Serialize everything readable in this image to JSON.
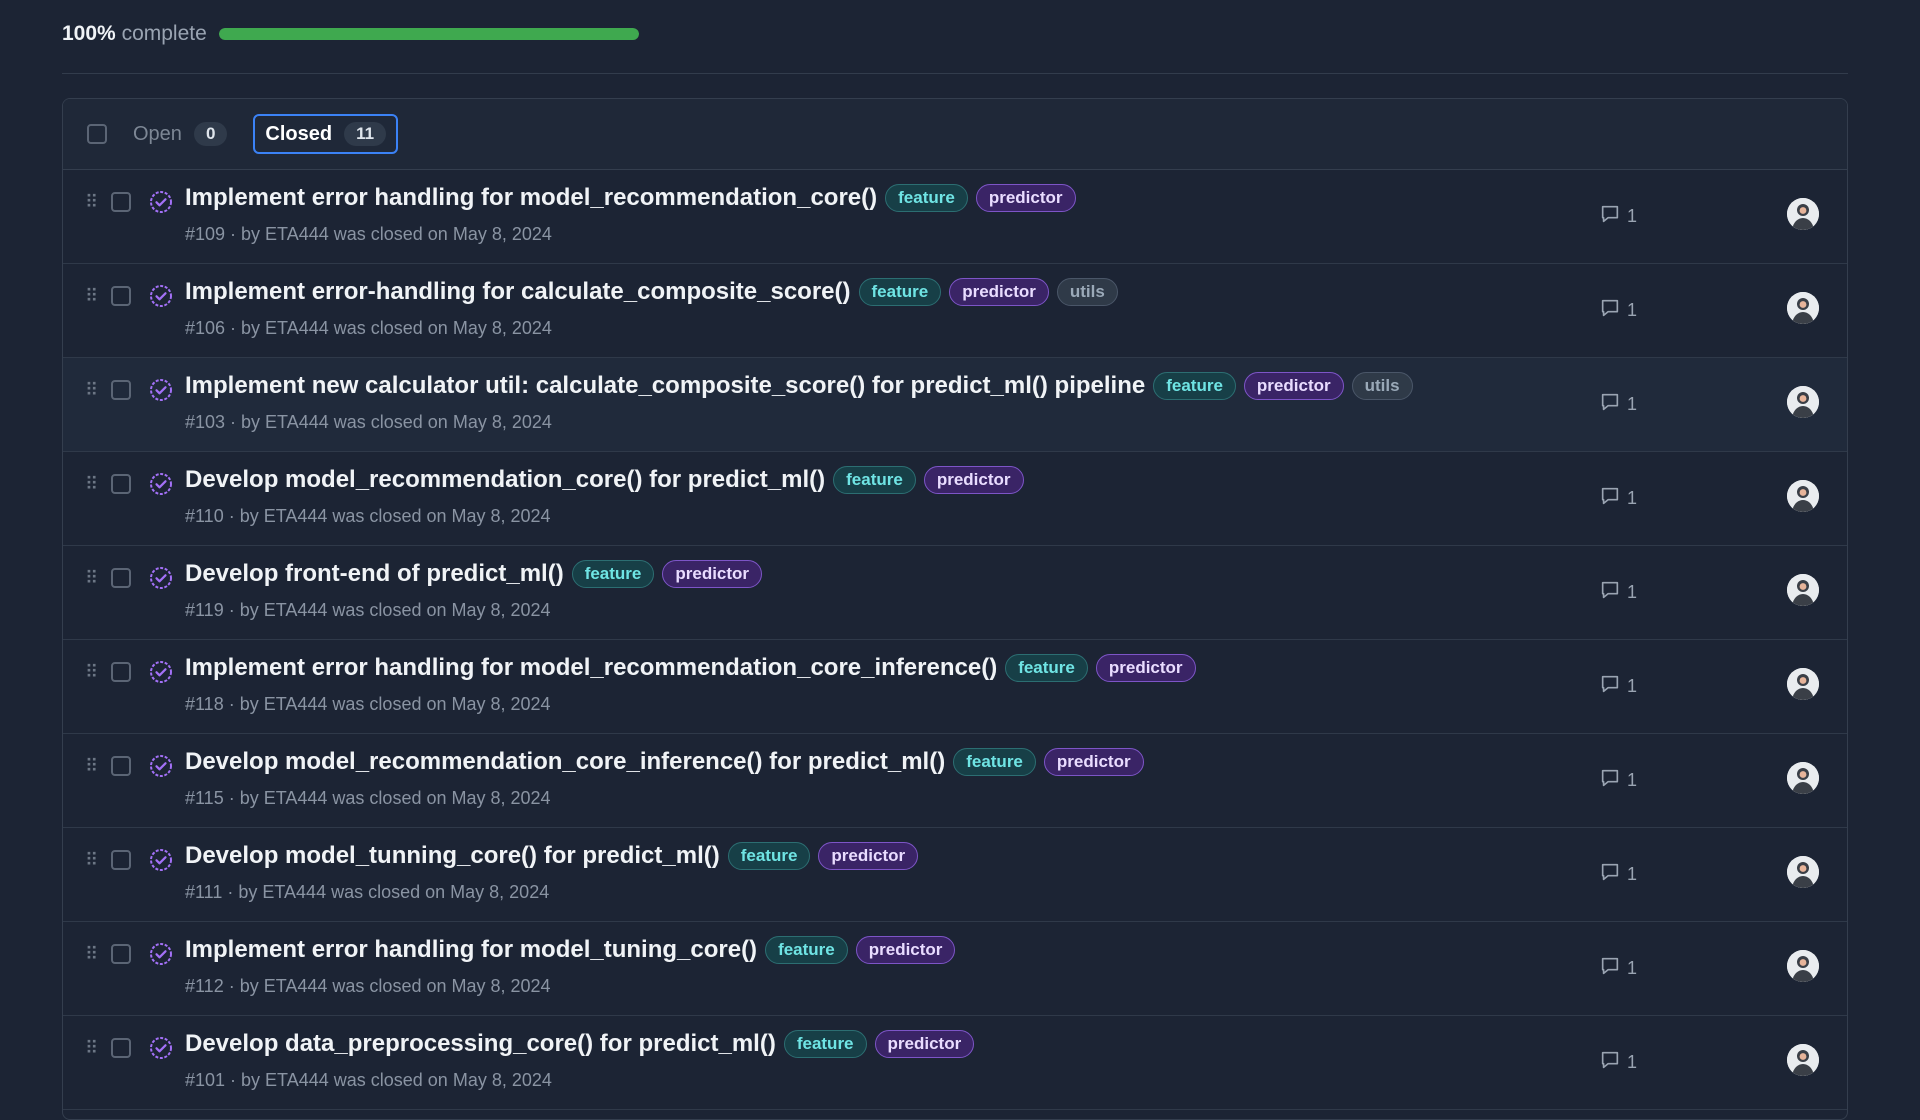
{
  "progress": {
    "percent_label": "100%",
    "complete_label": "complete",
    "fraction": 1.0
  },
  "filter": {
    "open": {
      "label": "Open",
      "count": "0"
    },
    "closed": {
      "label": "Closed",
      "count": "11"
    }
  },
  "colors": {
    "accent": "#3b82f6",
    "progress": "#3fa94f",
    "feature": "#6fe4e4",
    "predictor": "#7d55c7"
  },
  "issues": [
    {
      "title": "Implement error handling for model_recommendation_core()",
      "labels": [
        "feature",
        "predictor"
      ],
      "meta": "#109 · by ETA444 was closed on May 8, 2024",
      "comments": "1"
    },
    {
      "title": "Implement error-handling for calculate_composite_score()",
      "labels": [
        "feature",
        "predictor",
        "utils"
      ],
      "meta": "#106 · by ETA444 was closed on May 8, 2024",
      "comments": "1"
    },
    {
      "title": "Implement new calculator util: calculate_composite_score() for predict_ml() pipeline",
      "labels": [
        "feature",
        "predictor",
        "utils"
      ],
      "meta": "#103 · by ETA444 was closed on May 8, 2024",
      "comments": "1"
    },
    {
      "title": "Develop model_recommendation_core() for predict_ml()",
      "labels": [
        "feature",
        "predictor"
      ],
      "meta": "#110 · by ETA444 was closed on May 8, 2024",
      "comments": "1"
    },
    {
      "title": "Develop front-end of predict_ml()",
      "labels": [
        "feature",
        "predictor"
      ],
      "meta": "#119 · by ETA444 was closed on May 8, 2024",
      "comments": "1"
    },
    {
      "title": "Implement error handling for model_recommendation_core_inference()",
      "labels": [
        "feature",
        "predictor"
      ],
      "meta": "#118 · by ETA444 was closed on May 8, 2024",
      "comments": "1"
    },
    {
      "title": "Develop model_recommendation_core_inference() for predict_ml()",
      "labels": [
        "feature",
        "predictor"
      ],
      "meta": "#115 · by ETA444 was closed on May 8, 2024",
      "comments": "1"
    },
    {
      "title": "Develop model_tunning_core() for predict_ml()",
      "labels": [
        "feature",
        "predictor"
      ],
      "meta": "#111 · by ETA444 was closed on May 8, 2024",
      "comments": "1"
    },
    {
      "title": "Implement error handling for model_tuning_core()",
      "labels": [
        "feature",
        "predictor"
      ],
      "meta": "#112 · by ETA444 was closed on May 8, 2024",
      "comments": "1"
    },
    {
      "title": "Develop data_preprocessing_core() for predict_ml()",
      "labels": [
        "feature",
        "predictor"
      ],
      "meta": "#101 · by ETA444 was closed on May 8, 2024",
      "comments": "1"
    }
  ]
}
